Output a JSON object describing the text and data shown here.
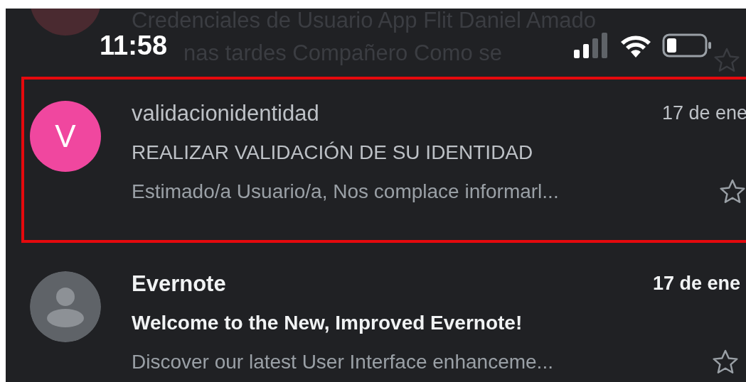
{
  "status_bar": {
    "time": "11:58"
  },
  "faded_row": {
    "subject": "Credenciales de Usuario App Flit Daniel Amado",
    "snippet": "nas tardes Compañero Como se",
    "starred": false
  },
  "emails": [
    {
      "sender": "validacionidentidad",
      "date": "17 de ene",
      "subject": "REALIZAR VALIDACIÓN DE SU IDENTIDAD",
      "snippet": "Estimado/a Usuario/a, Nos complace informarl...",
      "unread": false,
      "selected": true,
      "starred": false,
      "avatar": {
        "kind": "letter",
        "letter": "V",
        "color": "#f0479f"
      }
    },
    {
      "sender": "Evernote",
      "date": "17 de ene",
      "subject": "Welcome to the New, Improved Evernote!",
      "snippet": "Discover our latest User Interface enhanceme...",
      "unread": true,
      "selected": false,
      "starred": false,
      "avatar": {
        "kind": "person",
        "color": "#5f6368"
      }
    }
  ]
}
